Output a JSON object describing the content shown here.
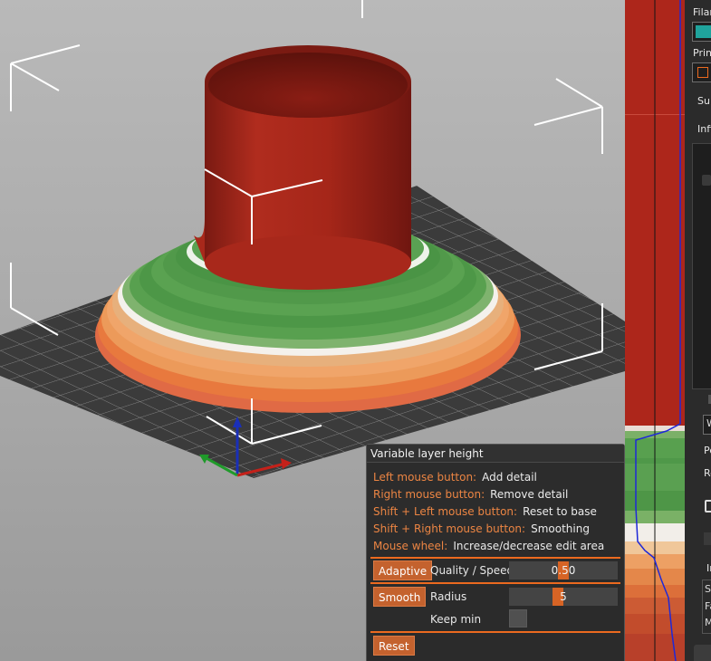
{
  "variable_layer_height": {
    "title": "Variable layer height",
    "hints": [
      {
        "key": "Left mouse button:",
        "action": "Add detail"
      },
      {
        "key": "Right mouse button:",
        "action": "Remove detail"
      },
      {
        "key": "Shift + Left mouse button:",
        "action": "Reset to base"
      },
      {
        "key": "Shift + Right mouse button:",
        "action": "Smoothing"
      },
      {
        "key": "Mouse wheel:",
        "action": "Increase/decrease edit area"
      }
    ],
    "adaptive_button": "Adaptive",
    "quality_speed_label": "Quality / Speed",
    "quality_speed_value": "0.50",
    "smooth_button": "Smooth",
    "radius_label": "Radius",
    "radius_value": "5",
    "keep_min_label": "Keep min",
    "keep_min_checked": false,
    "reset_button": "Reset"
  },
  "side_panel": {
    "filament_label": "Filam",
    "printer_label": "Prin",
    "supports_label": "Su",
    "infill_label": "Infi",
    "row_labels": [
      "W",
      "Pe",
      "Re"
    ],
    "info_label": "In",
    "info_rows": [
      "Si",
      "Fa",
      "M"
    ],
    "filament_color": "#1fa39c"
  },
  "colors": {
    "accent": "#ec6a1f",
    "object_red": "#a5241a",
    "layer_green": "#4f9a4a",
    "bed": "#3a3a3a"
  }
}
